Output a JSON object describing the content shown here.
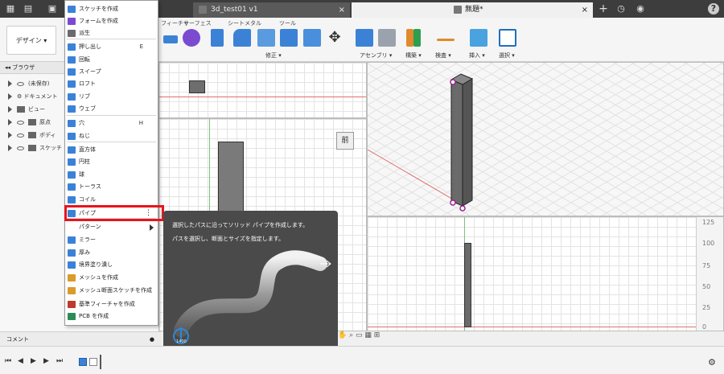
{
  "titlebar": {
    "tabs": [
      {
        "label": "3d_test01 v1",
        "close": "×"
      },
      {
        "label": "無題*",
        "close": "×"
      }
    ],
    "plus": "+",
    "help": "?"
  },
  "ribbon": {
    "design_label": "デザイン ▾",
    "tabs": [
      "フィーチャ",
      "サーフェス",
      "シートメタル",
      "ツール"
    ],
    "groups": [
      "修正 ▾",
      "アセンブリ ▾",
      "構築 ▾",
      "検査 ▾",
      "挿入 ▾",
      "選択 ▾"
    ]
  },
  "browser": {
    "title": "ブラウザ",
    "rows": [
      "(未保存)",
      "ドキュメント",
      "ビュー",
      "原点",
      "ボディ",
      "スケッチ"
    ],
    "comment": "コメント"
  },
  "menu": {
    "items": [
      {
        "label": "スケッチを作成",
        "color": "#3b82d6"
      },
      {
        "label": "フォームを作成",
        "color": "#7a4bd1"
      },
      {
        "label": "派生",
        "color": "#6b6b6b"
      },
      {
        "label": "押し出し",
        "shortcut": "E",
        "color": "#3b82d6"
      },
      {
        "label": "回転",
        "color": "#3b82d6"
      },
      {
        "label": "スイープ",
        "color": "#3b82d6"
      },
      {
        "label": "ロフト",
        "color": "#3b82d6"
      },
      {
        "label": "リブ",
        "color": "#3b82d6"
      },
      {
        "label": "ウェブ",
        "color": "#3b82d6"
      },
      {
        "label": "穴",
        "shortcut": "H",
        "color": "#3b82d6"
      },
      {
        "label": "ねじ",
        "color": "#3b82d6"
      },
      {
        "label": "直方体",
        "color": "#3b82d6"
      },
      {
        "label": "円柱",
        "color": "#3b82d6"
      },
      {
        "label": "球",
        "color": "#3b82d6"
      },
      {
        "label": "トーラス",
        "color": "#3b82d6"
      },
      {
        "label": "コイル",
        "color": "#3b82d6"
      },
      {
        "label": "パイプ",
        "color": "#3b82d6"
      },
      {
        "label": "パターン"
      },
      {
        "label": "ミラー",
        "color": "#3b82d6"
      },
      {
        "label": "厚み",
        "color": "#3b82d6"
      },
      {
        "label": "境界塗り潰し",
        "color": "#3b82d6"
      },
      {
        "label": "メッシュを作成",
        "color": "#d99b2a"
      },
      {
        "label": "メッシュ断面スケッチを作成",
        "color": "#d99b2a"
      },
      {
        "label": "基準フィーチャを作成",
        "color": "#c0392b"
      },
      {
        "label": "PCB を作成",
        "color": "#2e8b57"
      }
    ]
  },
  "tooltip": {
    "line1": "選択したパスに沿ってソリッド パイプを作成します。",
    "line2": "パスを選択し、断面とサイズを指定します。",
    "badge": "1400"
  },
  "viewports": {
    "front_label": "前",
    "ruler": [
      "125",
      "100",
      "75",
      "50",
      "25",
      "0"
    ]
  },
  "colors": {
    "highlight": "#e8141c",
    "tooltip_bg": "#4a4a4a",
    "accent": "#3b82d6"
  }
}
